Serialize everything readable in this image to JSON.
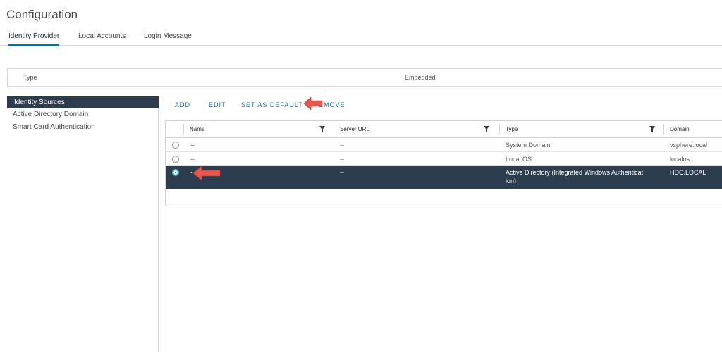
{
  "page": {
    "title": "Configuration"
  },
  "tabs": [
    {
      "label": "Identity Provider",
      "active": true
    },
    {
      "label": "Local Accounts",
      "active": false
    },
    {
      "label": "Login Message",
      "active": false
    }
  ],
  "type_bar": {
    "label": "Type",
    "value": "Embedded"
  },
  "left_nav": [
    {
      "label": "Identity Sources",
      "active": true
    },
    {
      "label": "Active Directory Domain",
      "active": false
    },
    {
      "label": "Smart Card Authentication",
      "active": false
    }
  ],
  "actions": {
    "add": "ADD",
    "edit": "EDIT",
    "set_default": "SET AS DEFAULT",
    "remove": "EMOVE"
  },
  "grid": {
    "columns": [
      "Name",
      "Server URL",
      "Type",
      "Domain"
    ],
    "rows": [
      {
        "name": "--",
        "server_url": "--",
        "type": "System Domain",
        "domain": "vsphere.local",
        "selected": false
      },
      {
        "name": "--",
        "server_url": "--",
        "type": "Local OS",
        "domain": "localos",
        "selected": false
      },
      {
        "name": "-",
        "server_url": "--",
        "type_line1": "Active Directory (Integrated Windows Authenticat",
        "type_line2": "ion)",
        "domain": "HDC.LOCAL",
        "selected": true
      }
    ]
  },
  "annotations": {
    "arrow_color": "#e8564d"
  }
}
